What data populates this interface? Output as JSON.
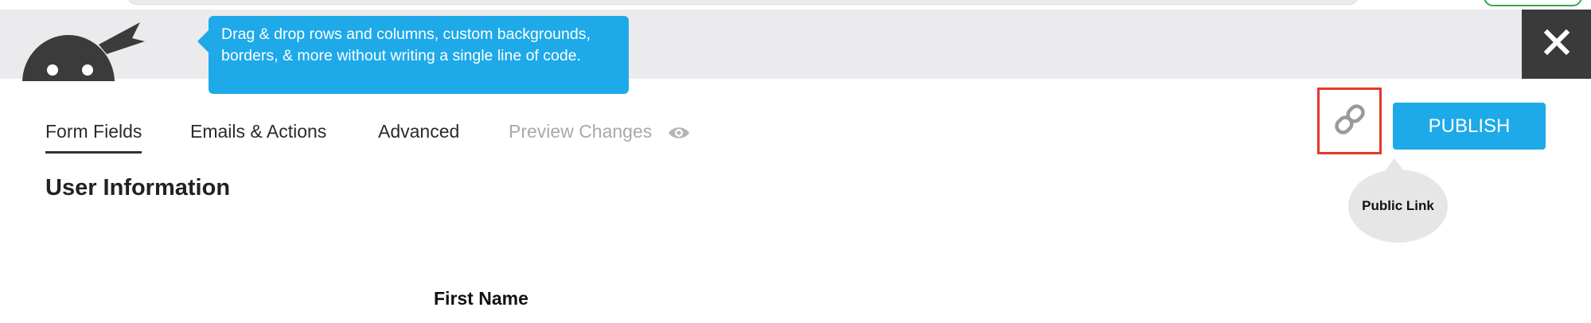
{
  "header": {
    "tooltip_text": "Drag & drop rows and columns, custom backgrounds, borders, & more without writing a single line of code.",
    "close_icon": "close-icon",
    "logo_icon": "ninja-logo-icon"
  },
  "tabs": [
    {
      "label": "Form Fields",
      "active": true
    },
    {
      "label": "Emails & Actions",
      "active": false
    },
    {
      "label": "Advanced",
      "active": false
    },
    {
      "label": "Preview Changes",
      "active": false,
      "icon": "eye-icon"
    }
  ],
  "actions": {
    "link_icon": "link-icon",
    "publish_label": "PUBLISH",
    "link_tooltip": "Public Link"
  },
  "main": {
    "section_title": "User Information",
    "field_label": "First Name"
  },
  "colors": {
    "accent": "#1ea9e9",
    "highlight_border": "#e5382a",
    "header_bg": "#ebebed",
    "close_bg": "#3a3a3a"
  }
}
